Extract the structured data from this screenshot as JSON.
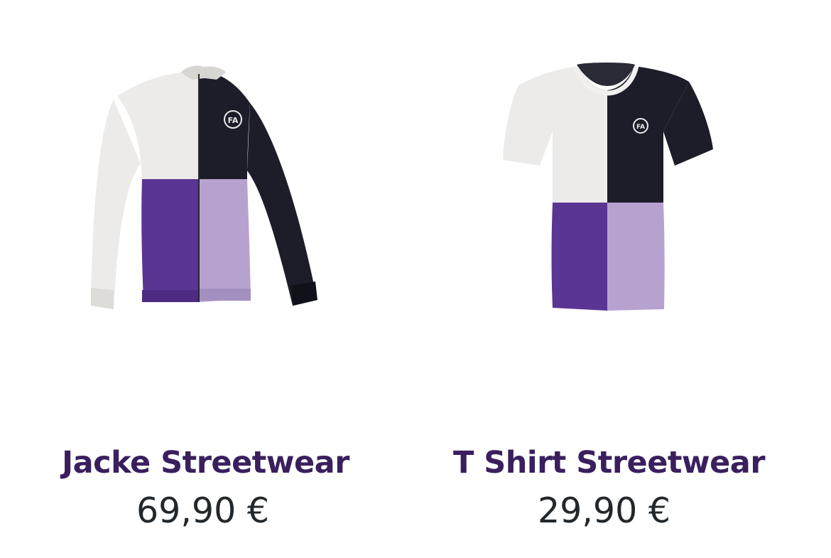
{
  "products": [
    {
      "title": "Jacke Streetwear",
      "price": "69,90 €",
      "image_alt": "Jacke Streetwear",
      "logo_text": "FA"
    },
    {
      "title": "T Shirt Streetwear",
      "price": "29,90 €",
      "image_alt": "T Shirt Streetwear",
      "logo_text": "FA"
    }
  ],
  "colors": {
    "title": "#3a1f5e",
    "price": "#22272b",
    "garment_white": "#ecebe9",
    "garment_black": "#1c1d29",
    "garment_purple": "#5b3594",
    "garment_lilac": "#b7a2cf"
  }
}
